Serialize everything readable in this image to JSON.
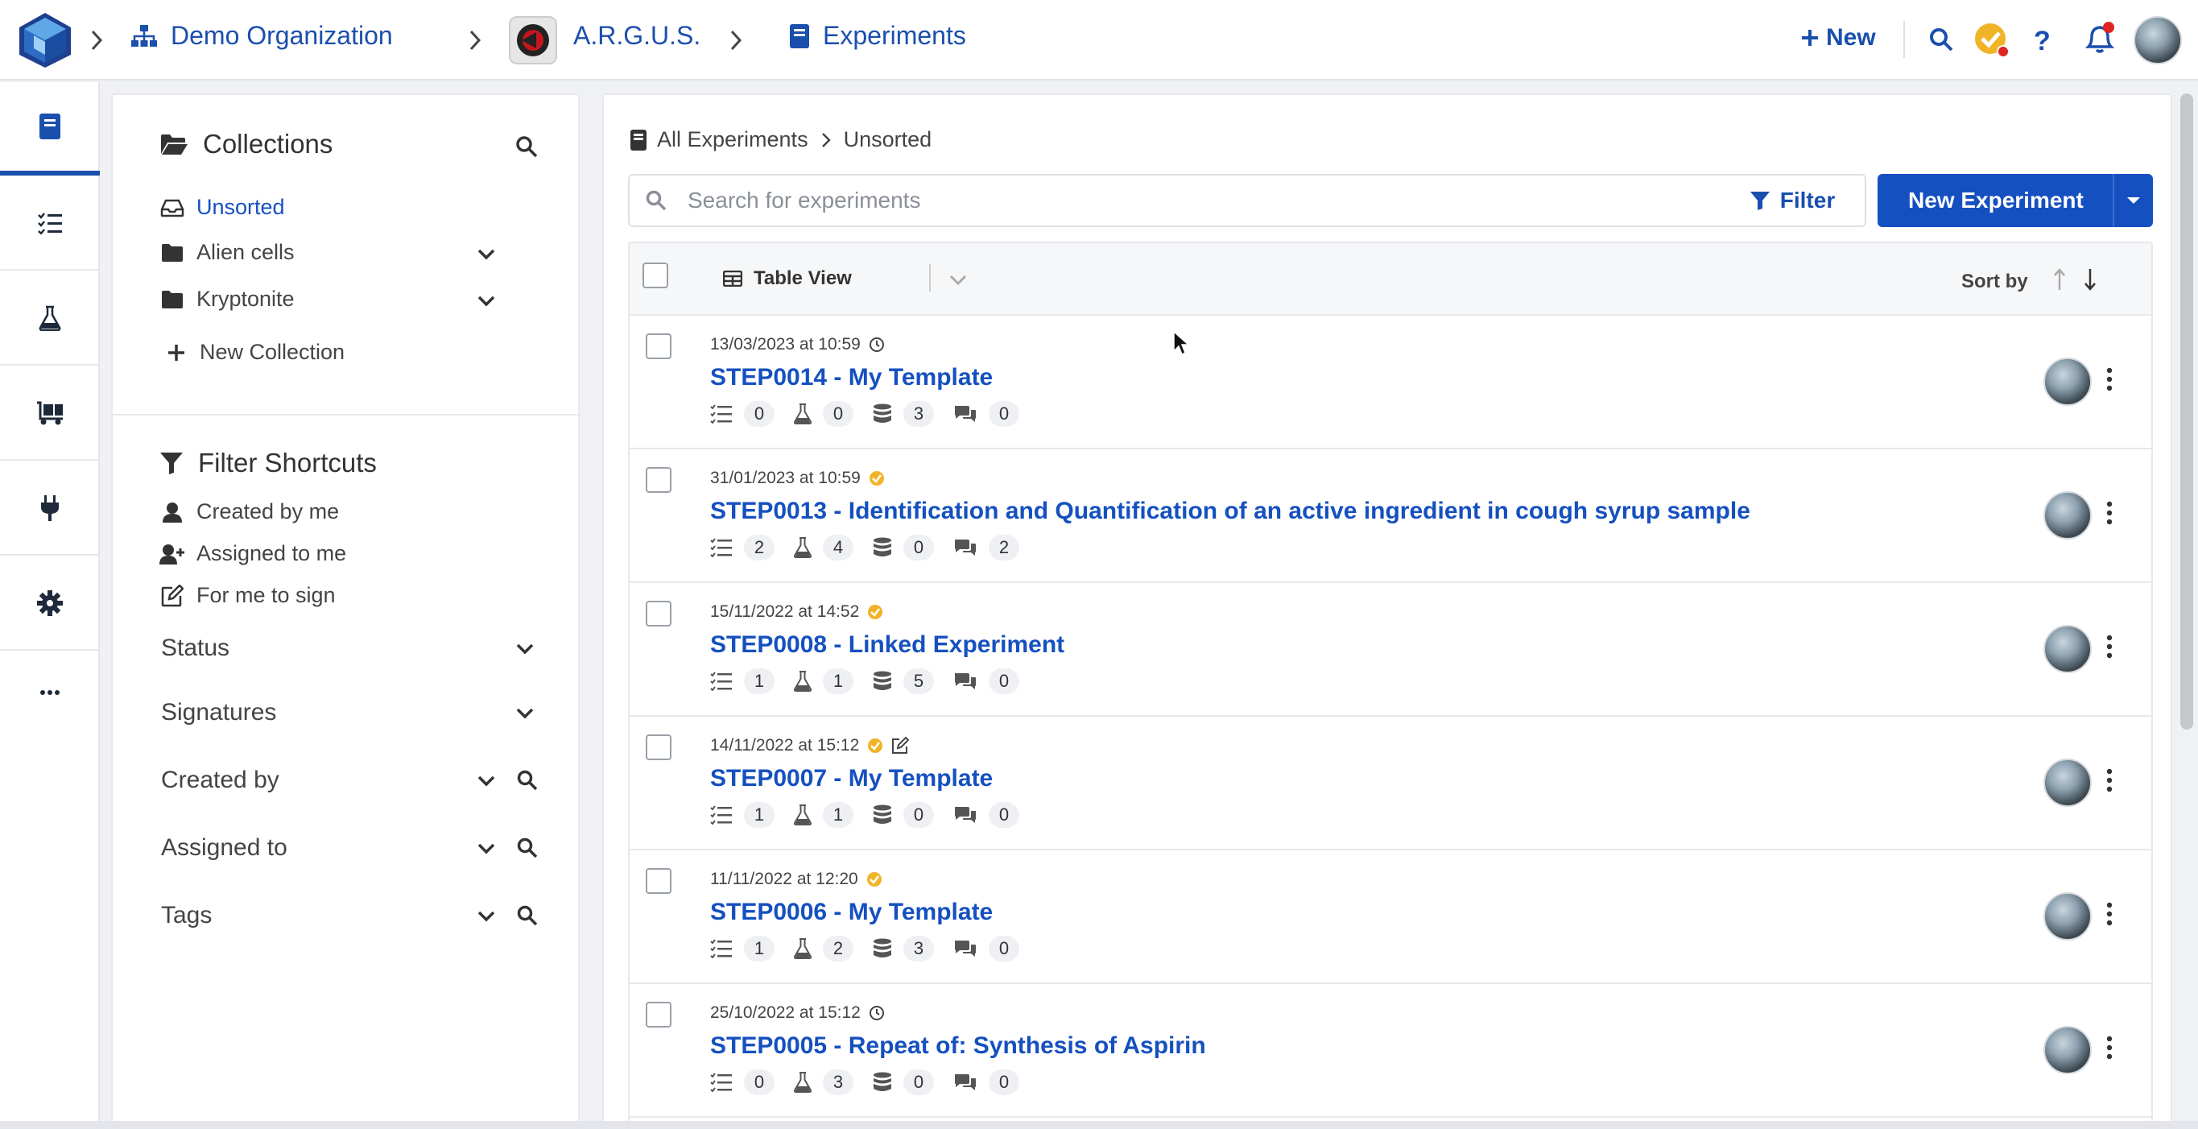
{
  "header": {
    "org": "Demo Organization",
    "project": "A.R.G.U.S.",
    "section": "Experiments",
    "new_label": "New"
  },
  "sidebar": {
    "collections_title": "Collections",
    "collections": [
      {
        "label": "Unsorted",
        "icon": "inbox-icon",
        "active": true
      },
      {
        "label": "Alien cells",
        "icon": "folder-icon"
      },
      {
        "label": "Kryptonite",
        "icon": "folder-icon"
      }
    ],
    "new_collection": "New Collection",
    "filter_title": "Filter Shortcuts",
    "shortcuts": [
      {
        "label": "Created by me",
        "icon": "user-icon"
      },
      {
        "label": "Assigned to me",
        "icon": "user-plus-icon"
      },
      {
        "label": "For me to sign",
        "icon": "edit-icon"
      }
    ],
    "sections": [
      "Status",
      "Signatures",
      "Created by",
      "Assigned to",
      "Tags"
    ]
  },
  "main": {
    "breadcrumb_root": "All Experiments",
    "breadcrumb_current": "Unsorted",
    "search_placeholder": "Search for experiments",
    "filter_label": "Filter",
    "new_experiment_label": "New Experiment",
    "table_view_label": "Table View",
    "sort_by_label": "Sort by"
  },
  "experiments": [
    {
      "date": "13/03/2023 at 10:59",
      "status": "clock",
      "title": "STEP0014 - My Template",
      "counts": [
        "0",
        "0",
        "3",
        "0"
      ]
    },
    {
      "date": "31/01/2023 at 10:59",
      "status": "check",
      "title": "STEP0013 - Identification and Quantification of an active ingredient in cough syrup sample",
      "counts": [
        "2",
        "4",
        "0",
        "2"
      ]
    },
    {
      "date": "15/11/2022 at 14:52",
      "status": "check",
      "title": "STEP0008 - Linked Experiment",
      "counts": [
        "1",
        "1",
        "5",
        "0"
      ]
    },
    {
      "date": "14/11/2022 at 15:12",
      "status": "check-edit",
      "title": "STEP0007 - My Template",
      "counts": [
        "1",
        "1",
        "0",
        "0"
      ]
    },
    {
      "date": "11/11/2022 at 12:20",
      "status": "check",
      "title": "STEP0006 - My Template",
      "counts": [
        "1",
        "2",
        "3",
        "0"
      ]
    },
    {
      "date": "25/10/2022 at 15:12",
      "status": "clock",
      "title": "STEP0005 - Repeat of: Synthesis of Aspirin",
      "counts": [
        "0",
        "3",
        "0",
        "0"
      ]
    }
  ],
  "colors": {
    "accent": "#1550c0",
    "link": "#1a4fad",
    "check": "#f0b429",
    "notify": "#e02424"
  }
}
